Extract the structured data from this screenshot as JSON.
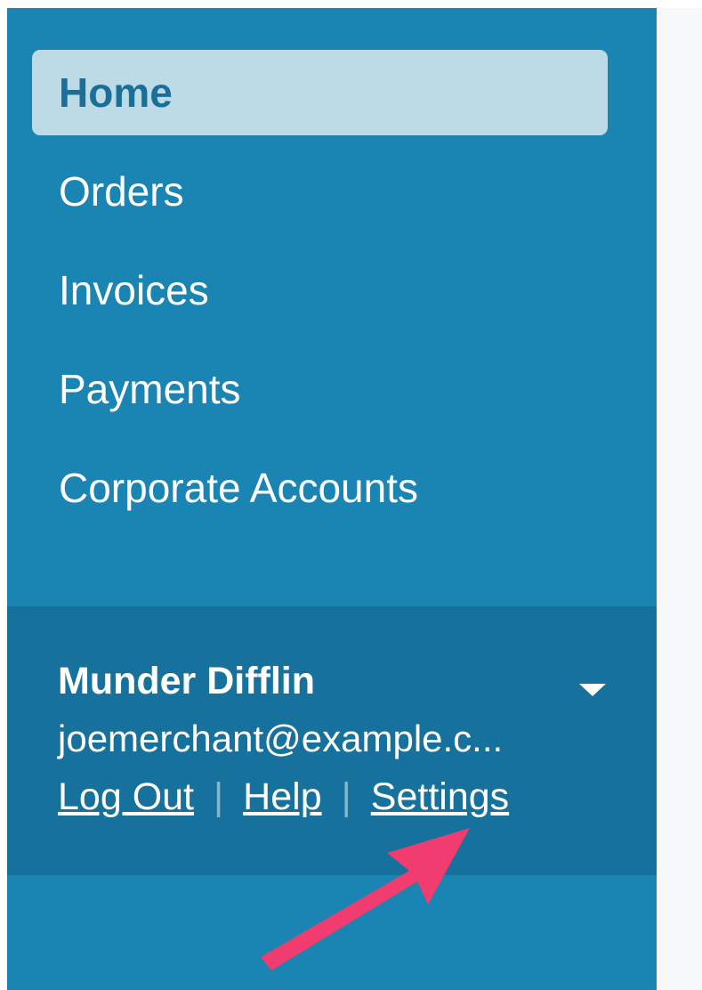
{
  "sidebar": {
    "items": [
      {
        "label": "Home",
        "active": true
      },
      {
        "label": "Orders",
        "active": false
      },
      {
        "label": "Invoices",
        "active": false
      },
      {
        "label": "Payments",
        "active": false
      },
      {
        "label": "Corporate Accounts",
        "active": false
      }
    ]
  },
  "account": {
    "name": "Munder Difflin",
    "email": "joemerchant@example.c...",
    "links": {
      "logout": "Log Out",
      "help": "Help",
      "settings": "Settings",
      "separator": "|"
    }
  },
  "colors": {
    "sidebar_bg": "#1a84b2",
    "account_bg": "#16729c",
    "active_item_bg": "#bcdbe7",
    "active_item_text": "#1a6f99",
    "arrow": "#f03c6e"
  }
}
